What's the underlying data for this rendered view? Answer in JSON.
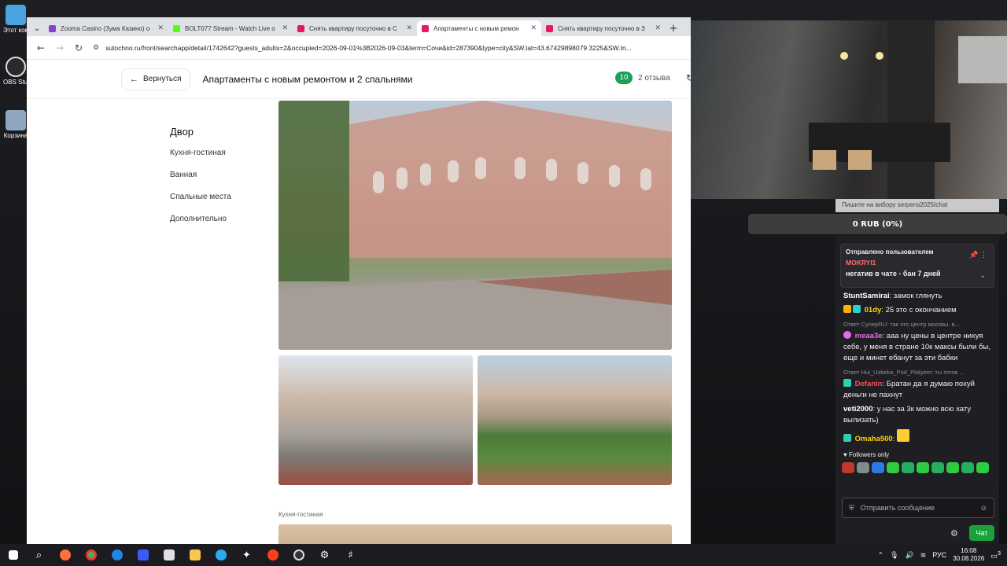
{
  "desktop": {
    "icons": [
      {
        "label": "Этот компьютер",
        "color": "#4aa3e0"
      },
      {
        "label": "OBS Studio",
        "color": "#2a2a2a"
      },
      {
        "label": "Корзина",
        "color": "#8fa6c0"
      }
    ]
  },
  "browser": {
    "tabs": [
      {
        "title": "Zooma Casino (Зума Казино) о",
        "favicon_color": "#8b3fcf",
        "active": false
      },
      {
        "title": "BOLT077 Stream - Watch Live o",
        "favicon_color": "#53fc18",
        "active": false
      },
      {
        "title": "Снять квартиру посуточно в С",
        "favicon_color": "#e5195f",
        "active": false
      },
      {
        "title": "Апартаменты с новым ремон",
        "favicon_color": "#e5195f",
        "active": true
      },
      {
        "title": "Снять квартиру посуточно в З",
        "favicon_color": "#e5195f",
        "active": false
      }
    ],
    "url": "sutochno.ru/front/searchapp/detail/1742642?guests_adults=2&occupied=2026-09-01%3B2026-09-03&term=Сочи&id=287390&type=city&SW.lat=43.67429898079 3225&SW.In..."
  },
  "page": {
    "back_label": "Вернуться",
    "title": "Апартаменты с новым ремонтом и 2 спальнями",
    "rating": "10",
    "reviews": "2 отзыва",
    "nav_header": "Двор",
    "nav_items": [
      "Кухня-гостиная",
      "Ванная",
      "Спальные места",
      "Дополнительно"
    ],
    "kitchen_label": "Кухня-гостиная"
  },
  "overlay": {
    "chat_url": "Пишите на вибору serpens2025/chat",
    "donation": "0 RUB (0%)"
  },
  "chat": {
    "pinned_header": "Отправлено пользователем",
    "pinned_user": "MOKRYI1",
    "pinned_message": "негатив в чате - бан 7 дней",
    "messages": [
      {
        "type": "msg",
        "user": "StuntSamirai",
        "color": "#ffffff",
        "text": "замок глянуть"
      },
      {
        "type": "msg",
        "user": "01dy",
        "color": "#ffd400",
        "text": "25 это с окончанием"
      },
      {
        "type": "reply",
        "text": "Ответ CynepRU: так это центр москвы. в..."
      },
      {
        "type": "msg",
        "user": "meaa3e",
        "color": "#e36bf0",
        "text": "ааа ну цены в центре нихуя себе, у меня в стране 10к максы были бы, еще и минет ебанут за эти бабки"
      },
      {
        "type": "reply",
        "text": "Ответ Hui_Uzbeka_Pod_Platyem: ты готов ..."
      },
      {
        "type": "msg",
        "user": "Defanin",
        "color": "#ff4d4d",
        "text": "Братан да я думаю похуй деньги не пахнут"
      },
      {
        "type": "msg",
        "user": "veti2000",
        "color": "#ffffff",
        "text": "у нас за 3к можно всю хату вылизать)"
      },
      {
        "type": "msg",
        "user": "Omaha500",
        "color": "#ffd400",
        "text": ""
      }
    ],
    "followers_only": "Followers only",
    "input_placeholder": "Отправить сообщение",
    "send_label": "Чат"
  },
  "taskbar": {
    "language": "РУС",
    "time": "16:08",
    "date": "30.08.2026",
    "notifications": "3"
  }
}
